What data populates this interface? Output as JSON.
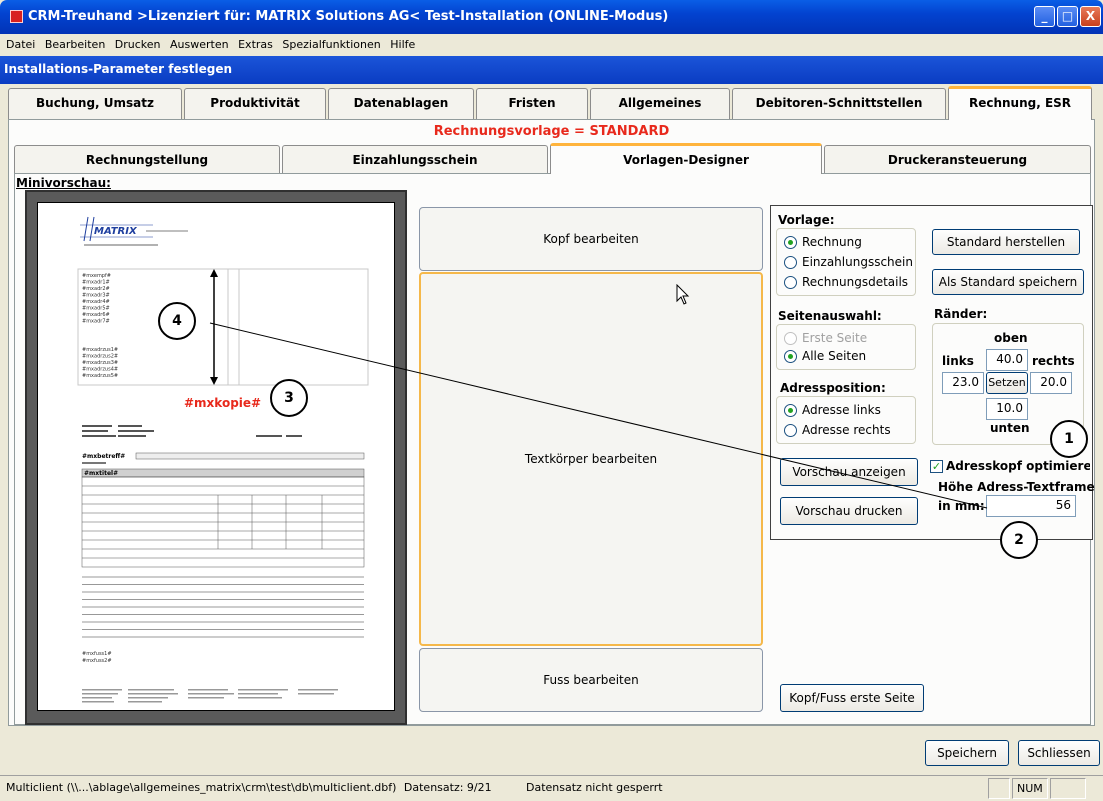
{
  "window": {
    "title": "CRM-Treuhand >Lizenziert für: MATRIX Solutions AG< Test-Installation (ONLINE-Modus)",
    "min_label": "_",
    "max_label": "□",
    "close_label": "X"
  },
  "menu": [
    "Datei",
    "Bearbeiten",
    "Drucken",
    "Auswerten",
    "Extras",
    "Spezialfunktionen",
    "Hilfe"
  ],
  "subwindow_title": "Installations-Parameter festlegen",
  "main_tabs": [
    "Buchung, Umsatz",
    "Produktivität",
    "Datenablagen",
    "Fristen",
    "Allgemeines",
    "Debitoren-Schnittstellen",
    "Rechnung, ESR"
  ],
  "main_tab_active": "Rechnung, ESR",
  "vorlage_title": "Rechnungsvorlage = STANDARD",
  "sub_tabs": [
    "Rechnungstellung",
    "Einzahlungsschein",
    "Vorlagen-Designer",
    "Druckeransteuerung"
  ],
  "sub_tab_active": "Vorlagen-Designer",
  "minivorschau": {
    "label": "Minivorschau:",
    "logo": "MATRIX",
    "address_fields": [
      "#mxempf#",
      "#mxadr1#",
      "#mxadr2#",
      "#mxadr3#",
      "#mxadr4#",
      "#mxadr5#",
      "#mxadr6#",
      "#mxadr7#"
    ],
    "address_fields2": [
      "#mxadrzus1#",
      "#mxadrzus2#",
      "#mxadrzus3#",
      "#mxadrzus4#",
      "#mxadrzus5#"
    ],
    "kopie_label": "#mxkopie#",
    "betreff": "#mxbetreff#",
    "titel": "#mxtitel#",
    "fuss1": "#mxfuss1#",
    "fuss2": "#mxfuss2#"
  },
  "designer_buttons": {
    "kopf": "Kopf bearbeiten",
    "textkoerper": "Textkörper bearbeiten",
    "fuss": "Fuss bearbeiten"
  },
  "vorlage": {
    "label": "Vorlage:",
    "options": [
      "Rechnung",
      "Einzahlungsschein",
      "Rechnungsdetails"
    ],
    "selected": "Rechnung"
  },
  "buttons": {
    "standard_herstellen": "Standard herstellen",
    "als_standard": "Als Standard speichern",
    "vorschau_anzeigen": "Vorschau anzeigen",
    "vorschau_drucken": "Vorschau drucken",
    "kopf_fuss_erste": "Kopf/Fuss erste Seite",
    "setzen": "Setzen",
    "speichern": "Speichern",
    "schliessen": "Schliessen"
  },
  "seitenauswahl": {
    "label": "Seitenauswahl:",
    "options": [
      "Erste Seite",
      "Alle Seiten"
    ],
    "selected": "Alle Seiten",
    "disabled": [
      "Erste Seite"
    ]
  },
  "adressposition": {
    "label": "Adressposition:",
    "options": [
      "Adresse links",
      "Adresse rechts"
    ],
    "selected": "Adresse links"
  },
  "raender": {
    "label": "Ränder:",
    "oben_label": "oben",
    "unten_label": "unten",
    "links_label": "links",
    "rechts_label": "rechts",
    "oben": "40.0",
    "links": "23.0",
    "rechts": "20.0",
    "unten": "10.0"
  },
  "adresskopf": {
    "checkbox_label": "Adresskopf optimieren",
    "checked": true,
    "hoehe_label": "Höhe Adress-Textframe",
    "in_mm_label": "in mm:",
    "value": "56"
  },
  "annotations": [
    "1",
    "2",
    "3",
    "4"
  ],
  "statusbar": {
    "path": "Multiclient (\\\\...\\ablage\\allgemeines_matrix\\crm\\test\\db\\multiclient.dbf)",
    "datensatz": "Datensatz: 9/21",
    "lock": "Datensatz nicht gesperrt",
    "num": "NUM"
  },
  "colors": {
    "accent_title": "#0a5ee6",
    "tab_highlight": "#ffb43c",
    "red_text": "#e8291c",
    "radio_selected": "#21a121"
  }
}
